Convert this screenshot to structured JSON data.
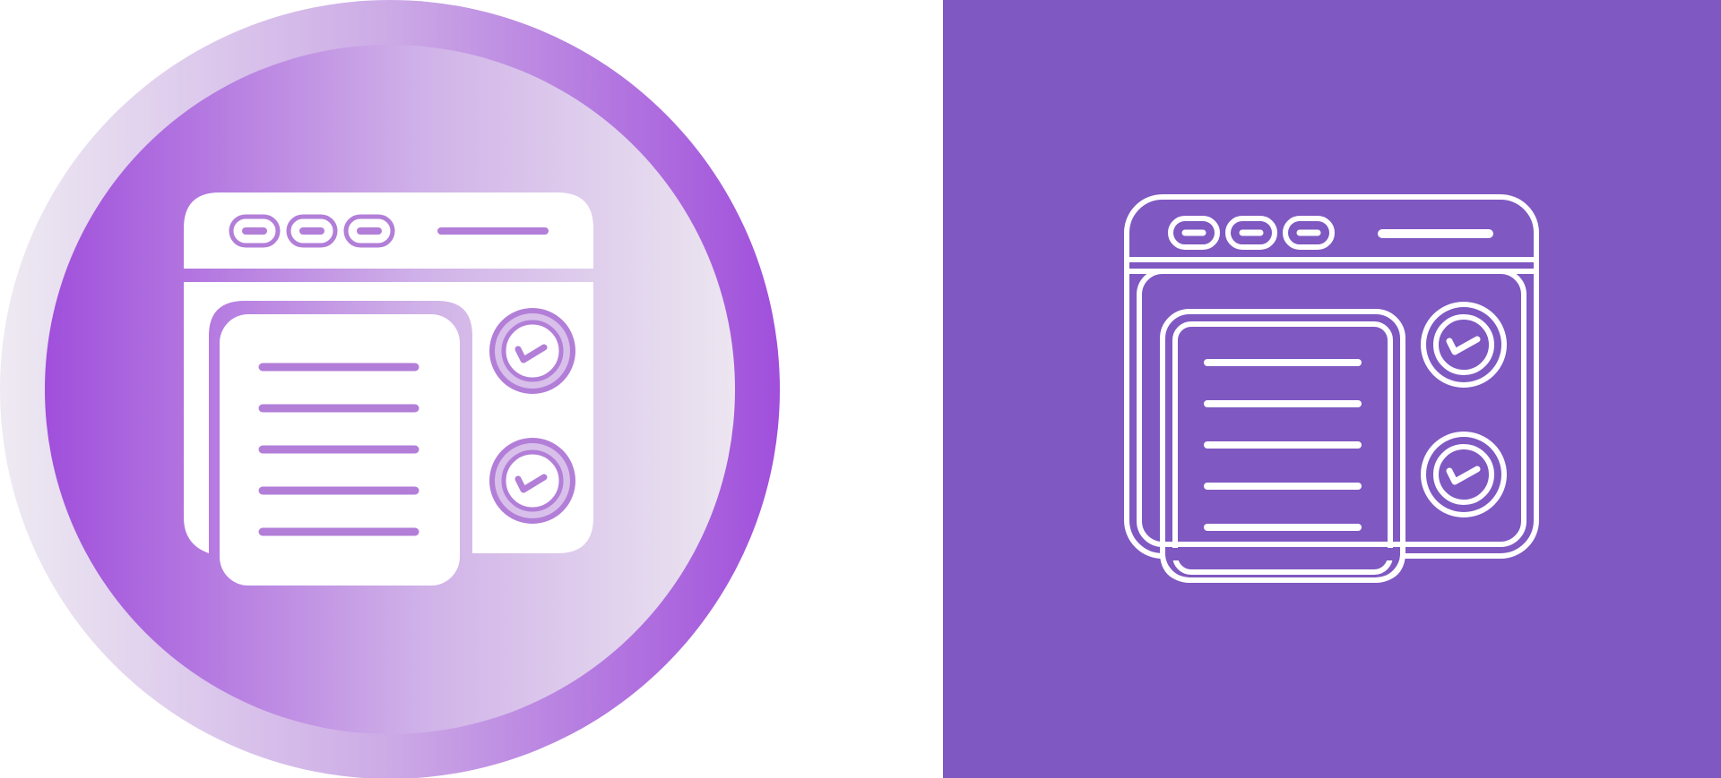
{
  "icons": [
    {
      "variant": "glyph-gradient",
      "semantic": "web-checklist-icon"
    },
    {
      "variant": "line-on-solid",
      "semantic": "web-checklist-icon"
    }
  ],
  "colors": {
    "purple_dark": "#9b4fd9",
    "purple_mid": "#b07fdf",
    "lavender_light": "#e4d6ef",
    "panel_purple": "#7f58c2",
    "white": "#ffffff"
  }
}
